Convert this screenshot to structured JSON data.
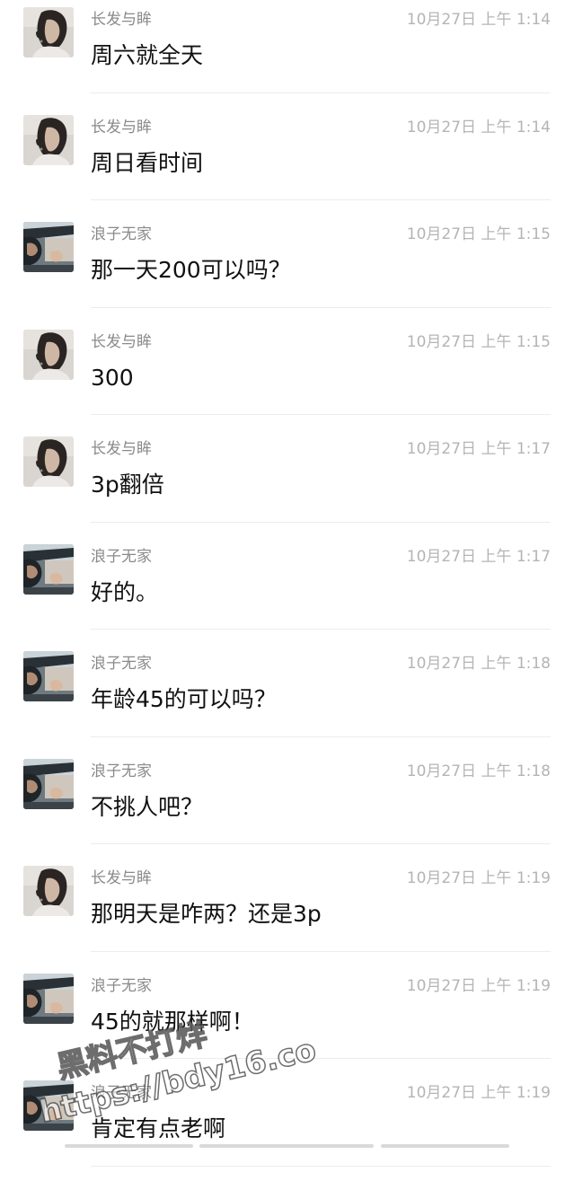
{
  "messages": [
    {
      "sender": "长发与眸",
      "avatar": "girl-avatar",
      "time": "10月27日 上午 1:14",
      "text": "周六就全天"
    },
    {
      "sender": "长发与眸",
      "avatar": "girl-avatar",
      "time": "10月27日 上午 1:14",
      "text": "周日看时间"
    },
    {
      "sender": "浪子无家",
      "avatar": "car-avatar",
      "time": "10月27日 上午 1:15",
      "text": "那一天200可以吗？"
    },
    {
      "sender": "长发与眸",
      "avatar": "girl-avatar",
      "time": "10月27日 上午 1:15",
      "text": "300"
    },
    {
      "sender": "长发与眸",
      "avatar": "girl-avatar",
      "time": "10月27日 上午 1:17",
      "text": "3p翻倍"
    },
    {
      "sender": "浪子无家",
      "avatar": "car-avatar",
      "time": "10月27日 上午 1:17",
      "text": "好的。"
    },
    {
      "sender": "浪子无家",
      "avatar": "car-avatar",
      "time": "10月27日 上午 1:18",
      "text": "年龄45的可以吗？"
    },
    {
      "sender": "浪子无家",
      "avatar": "car-avatar",
      "time": "10月27日 上午 1:18",
      "text": "不挑人吧？"
    },
    {
      "sender": "长发与眸",
      "avatar": "girl-avatar",
      "time": "10月27日 上午 1:19",
      "text": "那明天是咋两？还是3p"
    },
    {
      "sender": "浪子无家",
      "avatar": "car-avatar",
      "time": "10月27日 上午 1:19",
      "text": "45的就那样啊！"
    },
    {
      "sender": "浪子无家",
      "avatar": "car-avatar",
      "time": "10月27日 上午 1:19",
      "text": "肯定有点老啊"
    }
  ],
  "watermark": {
    "line1": "黑料不打烊",
    "line2": "https://bdy16.co"
  }
}
